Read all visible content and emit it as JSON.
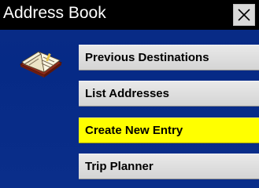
{
  "window": {
    "title": "Address Book",
    "close_label": "close"
  },
  "menu": {
    "items": [
      {
        "label": "Previous Destinations",
        "selected": false
      },
      {
        "label": "List Addresses",
        "selected": false
      },
      {
        "label": "Create New Entry",
        "selected": true
      },
      {
        "label": "Trip Planner",
        "selected": false
      }
    ]
  },
  "icons": {
    "close": "close-icon",
    "address_book": "address-book-icon"
  },
  "colors": {
    "background": "#0a2c86",
    "titlebar": "#000000",
    "button": "#dcdcdc",
    "selected": "#ffff00"
  }
}
